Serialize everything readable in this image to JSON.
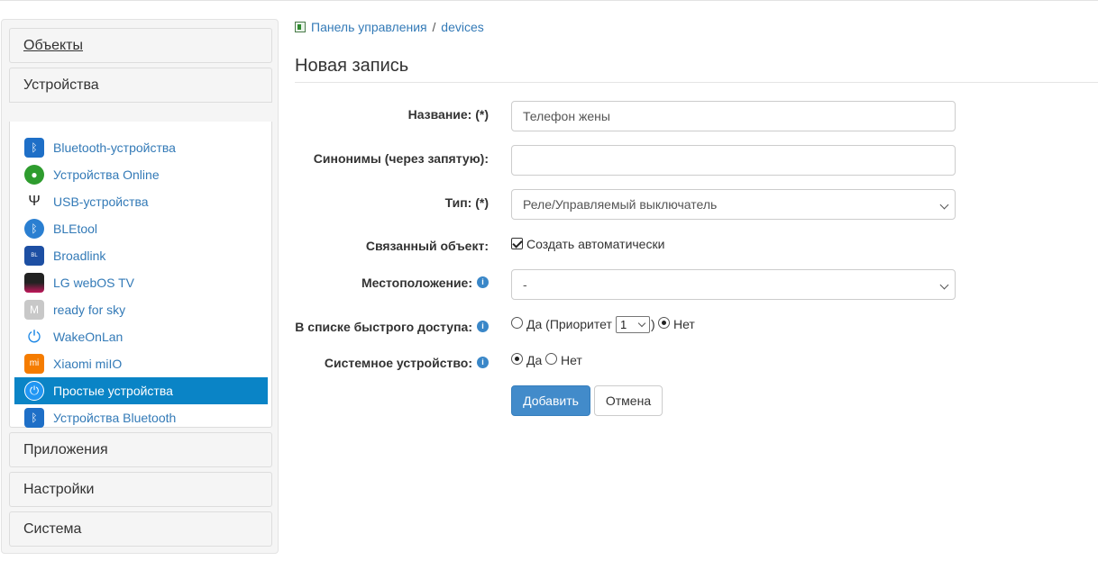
{
  "sidebar": {
    "objects_label": "Объекты",
    "devices_label": "Устройства",
    "items": [
      {
        "label": "Bluetooth-устройства",
        "icon": "bluetooth-icon",
        "color": "#1e6fc7"
      },
      {
        "label": "Устройства Online",
        "icon": "online-icon",
        "color": "#2e9c2e"
      },
      {
        "label": "USB-устройства",
        "icon": "usb-icon",
        "color": "#222222"
      },
      {
        "label": "BLEtool",
        "icon": "bletool-icon",
        "color": "#2a7fd1"
      },
      {
        "label": "Broadlink",
        "icon": "broadlink-icon",
        "color": "#1d4fa3"
      },
      {
        "label": "LG webOS TV",
        "icon": "lg-webos-icon",
        "color": "#c2185b"
      },
      {
        "label": "ready for sky",
        "icon": "ready-for-sky-icon",
        "color": "#c8c8c8"
      },
      {
        "label": "WakeOnLan",
        "icon": "power-icon",
        "color": "#1e88e5"
      },
      {
        "label": "Xiaomi miIO",
        "icon": "xiaomi-icon",
        "color": "#f57c00"
      },
      {
        "label": "Простые устройства",
        "icon": "power-icon",
        "color": "#2196f3",
        "active": true
      },
      {
        "label": "Устройства Bluetooth",
        "icon": "bluetooth-icon",
        "color": "#1e6fc7"
      }
    ],
    "apps_label": "Приложения",
    "settings_label": "Настройки",
    "system_label": "Система"
  },
  "breadcrumb": {
    "root": "Панель управления",
    "separator": "/",
    "current": "devices"
  },
  "page_title": "Новая запись",
  "form": {
    "name_label": "Название: (*)",
    "name_value": "Телефон жены",
    "synonyms_label": "Синонимы (через запятую):",
    "synonyms_value": "",
    "type_label": "Тип: (*)",
    "type_value": "Реле/Управляемый выключатель",
    "linked_object_label": "Связанный объект:",
    "linked_object_checkbox": "Создать автоматически",
    "location_label": "Местоположение:",
    "location_value": "-",
    "quick_access_label": "В списке быстрого доступа:",
    "quick_yes": "Да (Приоритет",
    "quick_priority": "1",
    "quick_close": ")",
    "quick_no": "Нет",
    "system_device_label": "Системное устройство:",
    "system_yes": "Да",
    "system_no": "Нет",
    "info_glyph": "i"
  },
  "buttons": {
    "add": "Добавить",
    "cancel": "Отмена"
  },
  "colors": {
    "link": "#337ab7",
    "active_bg": "#0a84c6",
    "primary_button": "#428bca"
  }
}
